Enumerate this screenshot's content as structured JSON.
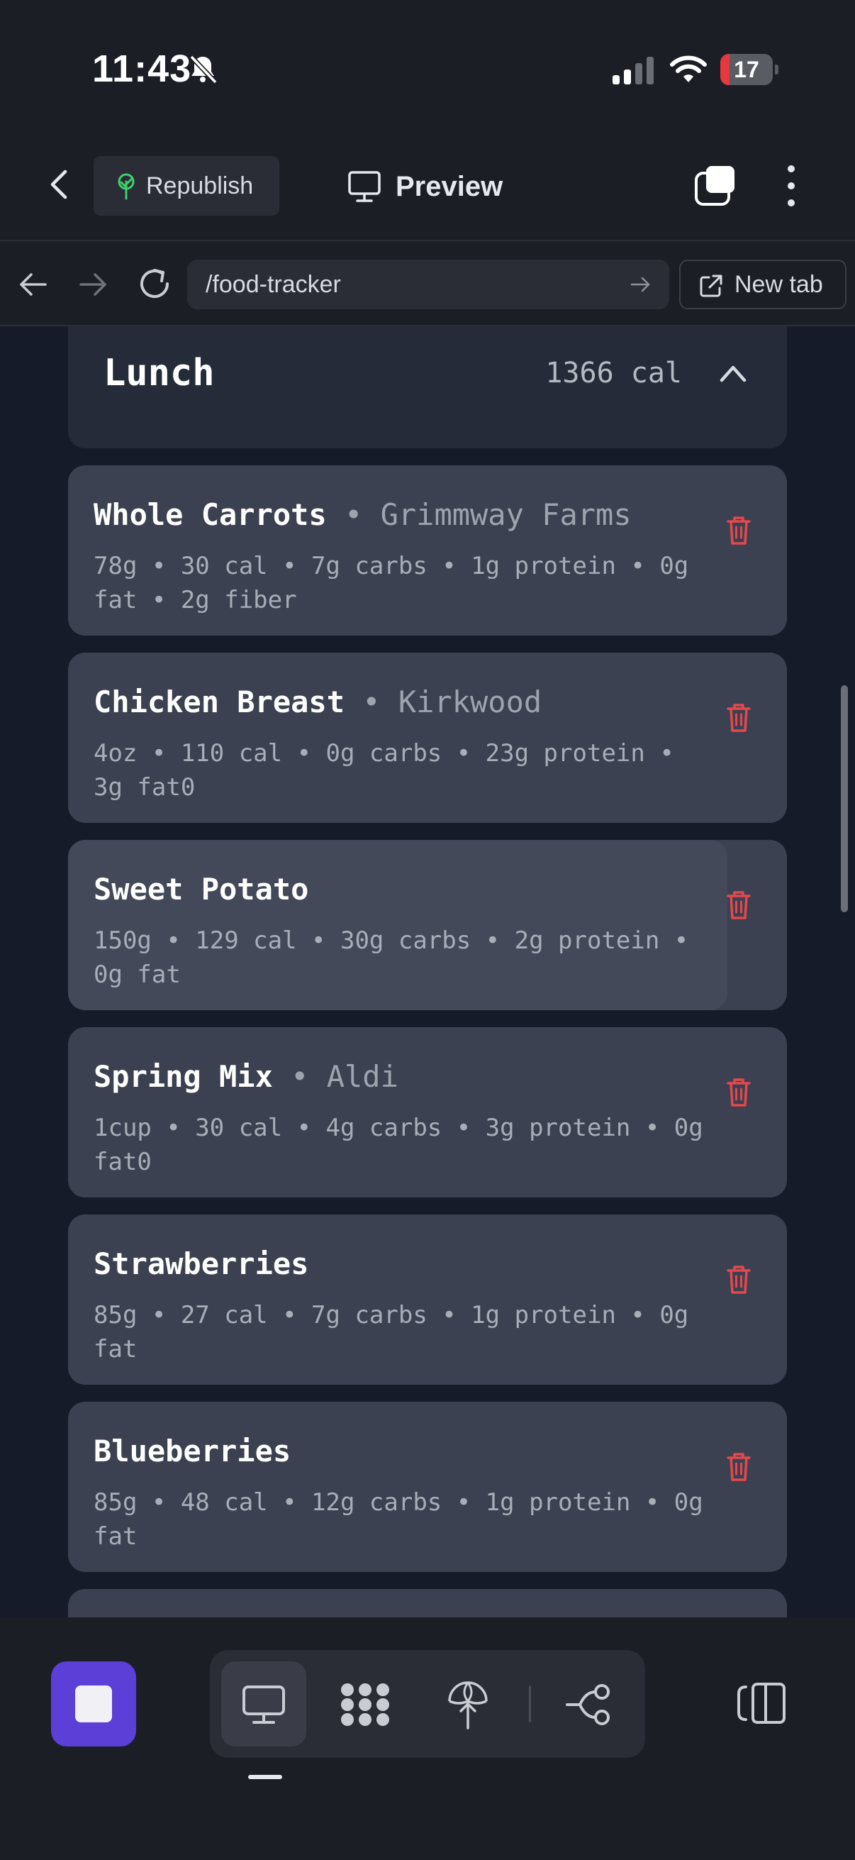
{
  "status_bar": {
    "time": "11:43",
    "battery": "17",
    "battery_level": 0.17
  },
  "header": {
    "republish_label": "Republish",
    "preview_label": "Preview"
  },
  "browser": {
    "url": "/food-tracker",
    "new_tab_label": "New tab"
  },
  "section": {
    "title": "Lunch",
    "calories": "1366 cal"
  },
  "items": [
    {
      "name": "Whole Carrots",
      "sep": " • ",
      "brand": "Grimmway Farms",
      "meta": "78g • 30 cal • 7g carbs • 1g protein • 0g fat • 2g fiber"
    },
    {
      "name": "Chicken Breast",
      "sep": " • ",
      "brand": "Kirkwood",
      "meta": "4oz • 110 cal • 0g carbs • 23g protein • 3g fat0"
    },
    {
      "name": "Sweet Potato",
      "sep": "",
      "brand": "",
      "meta": "150g • 129 cal • 30g carbs • 2g protein • 0g fat"
    },
    {
      "name": "Spring Mix",
      "sep": " • ",
      "brand": "Aldi",
      "meta": "1cup • 30 cal • 4g carbs • 3g protein • 0g fat0"
    },
    {
      "name": "Strawberries",
      "sep": "",
      "brand": "",
      "meta": "85g • 27 cal • 7g carbs • 1g protein • 0g fat"
    },
    {
      "name": "Blueberries",
      "sep": "",
      "brand": "",
      "meta": "85g • 48 cal • 12g carbs • 1g protein • 0g fat"
    }
  ],
  "colors": {
    "accent": "#5b3fd6",
    "trash": "#e5484d",
    "battery_low": "#e5383f",
    "republish_icon": "#3ecf6e"
  },
  "icons": [
    "bell-slash-icon",
    "signal-icon",
    "wifi-icon",
    "battery-icon",
    "back-icon",
    "sprout-icon",
    "monitor-icon",
    "tabs-icon",
    "more-vertical-icon",
    "arrow-left-icon",
    "arrow-right-icon",
    "reload-icon",
    "external-link-icon",
    "chevron-up-icon",
    "trash-icon",
    "stop-icon",
    "grid-dots-icon",
    "deploy-icon",
    "branch-icon",
    "side-panel-icon"
  ]
}
